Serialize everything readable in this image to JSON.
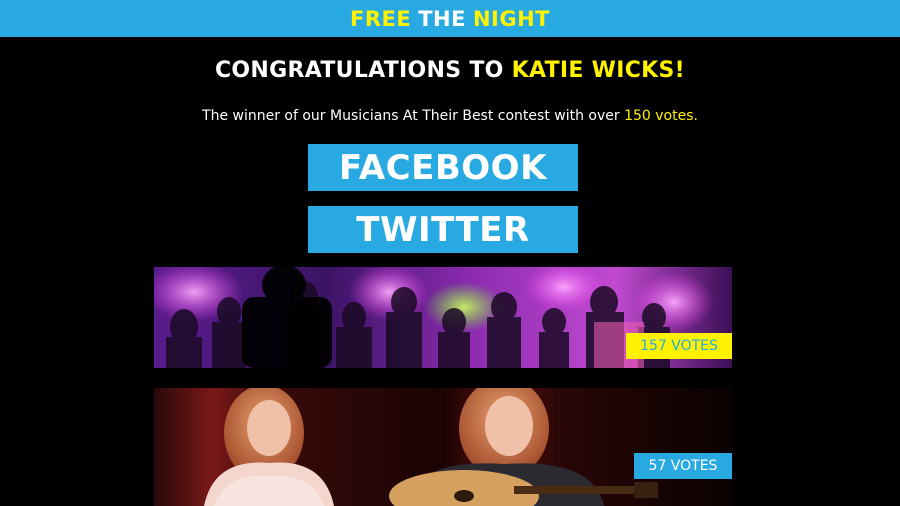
{
  "header": {
    "brand_part1": "FREE",
    "brand_part2": "THE",
    "brand_part3": "NIGHT"
  },
  "headline": {
    "prefix": "CONGRATULATIONS TO ",
    "name": "KATIE WICKS!"
  },
  "subline": {
    "prefix": "The winner of our Musicians At Their Best contest with over ",
    "votes": "150 votes."
  },
  "share": {
    "facebook_label": "FACEBOOK",
    "twitter_label": "TWITTER"
  },
  "entries": [
    {
      "votes_label": "157 VOTES"
    },
    {
      "votes_label": "57 VOTES"
    }
  ],
  "colors": {
    "accent_blue": "#29a9e1",
    "accent_yellow": "#fff200",
    "background": "#000000"
  }
}
